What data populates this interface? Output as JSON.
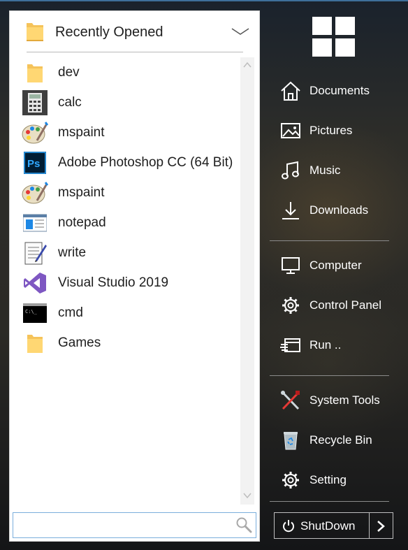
{
  "header": {
    "title": "Recently Opened"
  },
  "recent_items": [
    {
      "label": "dev",
      "icon": "folder-icon"
    },
    {
      "label": "calc",
      "icon": "calculator-icon"
    },
    {
      "label": "mspaint",
      "icon": "paint-palette-icon"
    },
    {
      "label": "Adobe Photoshop CC (64 Bit)",
      "icon": "photoshop-icon"
    },
    {
      "label": "mspaint",
      "icon": "paint-palette-icon"
    },
    {
      "label": "notepad",
      "icon": "notepad-icon"
    },
    {
      "label": "write",
      "icon": "write-icon"
    },
    {
      "label": "Visual Studio 2019",
      "icon": "visual-studio-icon"
    },
    {
      "label": "cmd",
      "icon": "cmd-icon"
    },
    {
      "label": "Games",
      "icon": "folder-icon"
    }
  ],
  "search": {
    "placeholder": ""
  },
  "nav": {
    "documents": "Documents",
    "pictures": "Pictures",
    "music": "Music",
    "downloads": "Downloads",
    "computer": "Computer",
    "control_panel": "Control Panel",
    "run": "Run ..",
    "system_tools": "System Tools",
    "recycle_bin": "Recycle Bin",
    "setting": "Setting"
  },
  "shutdown": {
    "label": "ShutDown"
  },
  "colors": {
    "accent": "#7aaedc",
    "folder": "#f7c45a",
    "photoshop": "#31a8ff",
    "visual_studio": "#7e57c2"
  }
}
